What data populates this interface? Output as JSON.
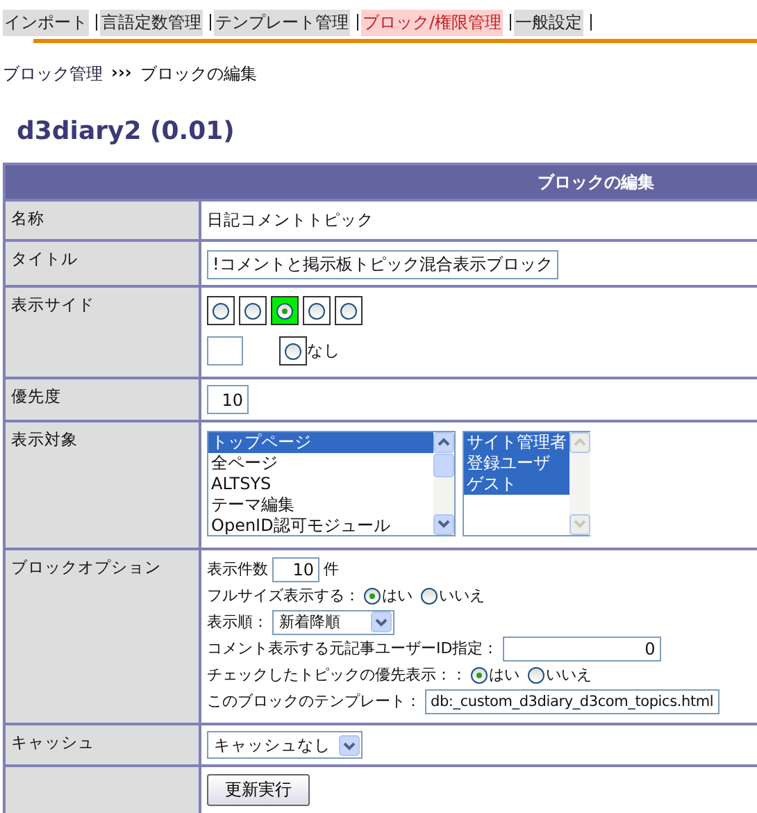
{
  "nav": {
    "items": [
      {
        "label": "インポート",
        "selected": false
      },
      {
        "label": "言語定数管理",
        "selected": false
      },
      {
        "label": "テンプレート管理",
        "selected": false
      },
      {
        "label": "ブロック/権限管理",
        "selected": true
      },
      {
        "label": "一般設定",
        "selected": false
      }
    ]
  },
  "breadcrumb": {
    "parent": "ブロック管理",
    "separator": "›››",
    "current": "ブロックの編集"
  },
  "module_title": "d3diary2 (0.01)",
  "form": {
    "header": "ブロックの編集",
    "name": {
      "label": "名称",
      "value": "日記コメントトピック"
    },
    "title": {
      "label": "タイトル",
      "value": "!コメントと掲示板トピック混合表示ブロック"
    },
    "side": {
      "label": "表示サイド",
      "positions": [
        {
          "selected": false
        },
        {
          "selected": false
        },
        {
          "selected": true
        },
        {
          "selected": false
        },
        {
          "selected": false
        }
      ],
      "none": {
        "label": "なし",
        "selected": false
      }
    },
    "weight": {
      "label": "優先度",
      "value": "10"
    },
    "targets": {
      "label": "表示対象",
      "pages": [
        {
          "label": "トップページ",
          "selected": true
        },
        {
          "label": "全ページ",
          "selected": false
        },
        {
          "label": "ALTSYS",
          "selected": false
        },
        {
          "label": "テーマ編集",
          "selected": false
        },
        {
          "label": "OpenID認可モジュール",
          "selected": false
        }
      ],
      "groups": [
        {
          "label": "サイト管理者",
          "selected": true
        },
        {
          "label": "登録ユーザ",
          "selected": true
        },
        {
          "label": "ゲスト",
          "selected": true
        }
      ]
    },
    "options": {
      "label": "ブロックオプション",
      "items": [
        {
          "kind": "count",
          "label": "表示件数",
          "value": "10",
          "suffix": "件"
        },
        {
          "kind": "radio",
          "label": "フルサイズ表示する：",
          "choices": [
            {
              "label": "はい",
              "selected": true
            },
            {
              "label": "いいえ",
              "selected": false
            }
          ]
        },
        {
          "kind": "select",
          "label": "表示順：",
          "value": "新着降順"
        },
        {
          "kind": "id",
          "label": "コメント表示する元記事ユーザーID指定：",
          "value": "0"
        },
        {
          "kind": "radio",
          "label": "チェックしたトピックの優先表示：：",
          "choices": [
            {
              "label": "はい",
              "selected": true
            },
            {
              "label": "いいえ",
              "selected": false
            }
          ]
        },
        {
          "kind": "template",
          "label": "このブロックのテンプレート：",
          "value": "db:_custom_d3diary_d3com_topics.html"
        }
      ]
    },
    "cache": {
      "label": "キャッシュ",
      "value": "キャッシュなし"
    },
    "submit": {
      "label": "更新実行"
    }
  }
}
